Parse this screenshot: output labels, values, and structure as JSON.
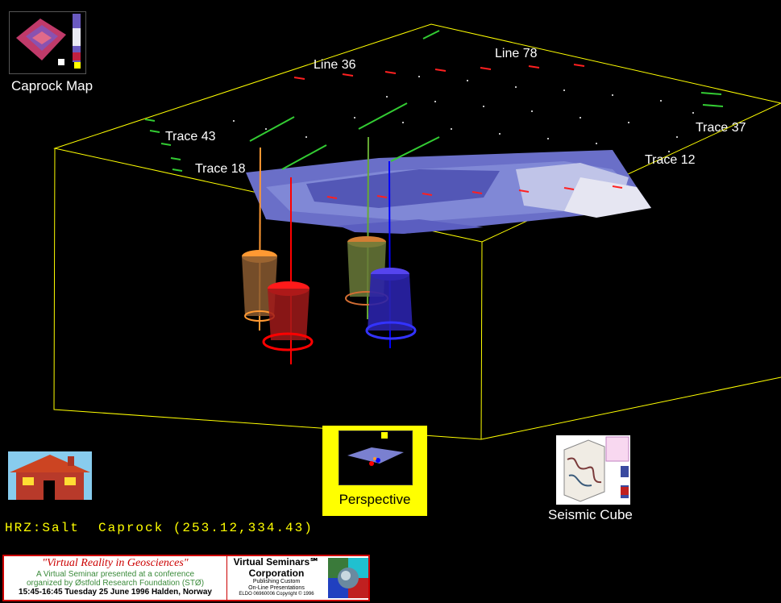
{
  "thumbnails": {
    "caprock_map": {
      "label": "Caprock Map"
    },
    "perspective": {
      "label": "Perspective"
    },
    "seismic_cube": {
      "label": "Seismic Cube"
    },
    "home": {
      "label": ""
    }
  },
  "scene_labels": {
    "line_36": "Line 36",
    "line_78": "Line 78",
    "trace_43": "Trace 43",
    "trace_18": "Trace 18",
    "trace_37": "Trace 37",
    "trace_12": "Trace 12"
  },
  "status": {
    "horizon_readout": "HRZ:Salt  Caprock (253.12,334.43)"
  },
  "banner": {
    "title": "\"Virtual Reality in Geosciences\"",
    "line1": "A Virtual Seminar presented at a conference",
    "line2": "organized by Østfold Research Foundation (STØ)",
    "date": "15:45-16:45 Tuesday 25 June 1996 Halden, Norway",
    "corp1": "Virtual Seminars℠",
    "corp2": "Corporation",
    "tag1": "Publishing Custom",
    "tag2": "On-Line Presentations",
    "copyright": "ELDO 06960006 Copyright © 1996"
  },
  "colors": {
    "box_edges": "#ffff00",
    "well_orange": "#ff9933",
    "well_red": "#ff0000",
    "well_green": "#66aa33",
    "well_blue": "#0000ff",
    "perspective_bg": "#ffff00"
  }
}
